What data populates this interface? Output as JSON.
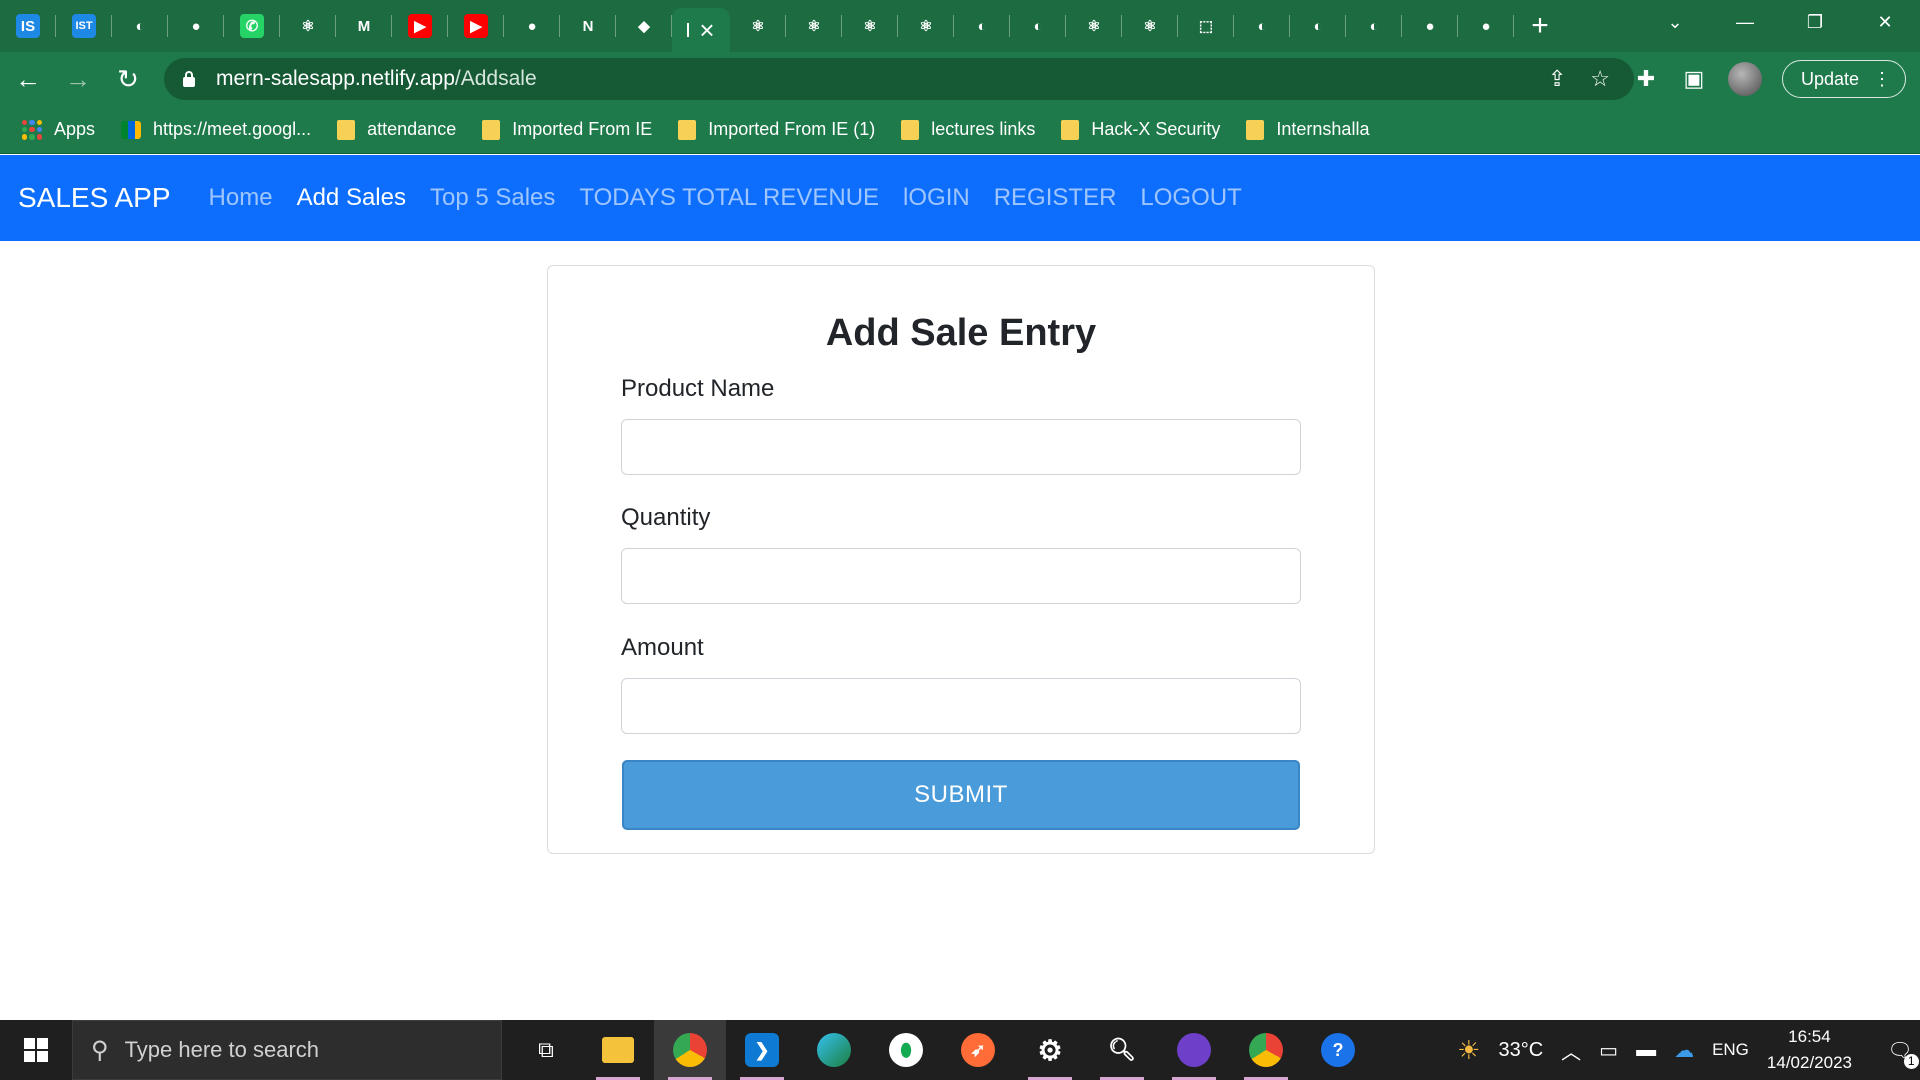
{
  "browser": {
    "tabs": [
      {
        "icon": "is-icon",
        "glyph": "IS",
        "bg": "#1e88e5"
      },
      {
        "icon": "ist-icon",
        "glyph": "IST",
        "bg": "#1e88e5"
      },
      {
        "icon": "globe-icon",
        "glyph": "◐",
        "bg": ""
      },
      {
        "icon": "github-icon",
        "glyph": "●",
        "bg": ""
      },
      {
        "icon": "whatsapp-icon",
        "glyph": "✆",
        "bg": "#25d366"
      },
      {
        "icon": "react-icon",
        "glyph": "⚛",
        "bg": ""
      },
      {
        "icon": "gmail-icon",
        "glyph": "M",
        "bg": ""
      },
      {
        "icon": "youtube-icon",
        "glyph": "▶",
        "bg": "#ff0000"
      },
      {
        "icon": "youtube-icon",
        "glyph": "▶",
        "bg": "#ff0000"
      },
      {
        "icon": "github-icon",
        "glyph": "●",
        "bg": ""
      },
      {
        "icon": "netlify-n-icon",
        "glyph": "N",
        "bg": ""
      },
      {
        "icon": "netlify-diamond-icon",
        "glyph": "◆",
        "bg": ""
      }
    ],
    "tabs_after": [
      {
        "icon": "react-icon",
        "glyph": "⚛"
      },
      {
        "icon": "react-icon",
        "glyph": "⚛"
      },
      {
        "icon": "react-icon",
        "glyph": "⚛"
      },
      {
        "icon": "react-icon",
        "glyph": "⚛"
      },
      {
        "icon": "globe-icon",
        "glyph": "◐"
      },
      {
        "icon": "globe-icon",
        "glyph": "◐"
      },
      {
        "icon": "react-icon",
        "glyph": "⚛"
      },
      {
        "icon": "react-icon",
        "glyph": "⚛"
      },
      {
        "icon": "codepen-icon",
        "glyph": "⬚"
      },
      {
        "icon": "globe-icon",
        "glyph": "◐"
      },
      {
        "icon": "globe-icon",
        "glyph": "◐"
      },
      {
        "icon": "globe-icon",
        "glyph": "◐"
      },
      {
        "icon": "github-icon",
        "glyph": "●"
      },
      {
        "icon": "github-icon",
        "glyph": "●"
      }
    ],
    "active_tab_close": "×",
    "new_tab": "+",
    "url_host": "mern-salesapp.netlify.app",
    "url_path": "/Addsale",
    "update_label": "Update",
    "bookmarks": [
      {
        "type": "apps",
        "label": "Apps"
      },
      {
        "type": "meet",
        "label": "https://meet.googl..."
      },
      {
        "type": "folder",
        "label": "attendance"
      },
      {
        "type": "folder",
        "label": "Imported From IE"
      },
      {
        "type": "folder",
        "label": "Imported From IE (1)"
      },
      {
        "type": "folder",
        "label": "lectures links"
      },
      {
        "type": "folder",
        "label": "Hack-X Security"
      },
      {
        "type": "folder",
        "label": "Internshalla"
      }
    ]
  },
  "app": {
    "brand": "SALES APP",
    "nav": [
      {
        "label": "Home",
        "active": false
      },
      {
        "label": "Add Sales",
        "active": true
      },
      {
        "label": "Top 5 Sales",
        "active": false
      },
      {
        "label": "TODAYS TOTAL REVENUE",
        "active": false
      },
      {
        "label": "lOGIN",
        "active": false
      },
      {
        "label": "REGISTER",
        "active": false
      },
      {
        "label": "LOGOUT",
        "active": false
      }
    ],
    "form": {
      "title": "Add Sale Entry",
      "fields": [
        {
          "label": "Product Name",
          "value": ""
        },
        {
          "label": "Quantity",
          "value": ""
        },
        {
          "label": "Amount",
          "value": ""
        }
      ],
      "submit_label": "SUBMIT"
    },
    "colors": {
      "navbar": "#0d6efd",
      "submit": "#4a9bd9"
    }
  },
  "taskbar": {
    "search_placeholder": "Type here to search",
    "temperature": "33°C",
    "language": "ENG",
    "time": "16:54",
    "date": "14/02/2023",
    "notification_count": "1"
  }
}
